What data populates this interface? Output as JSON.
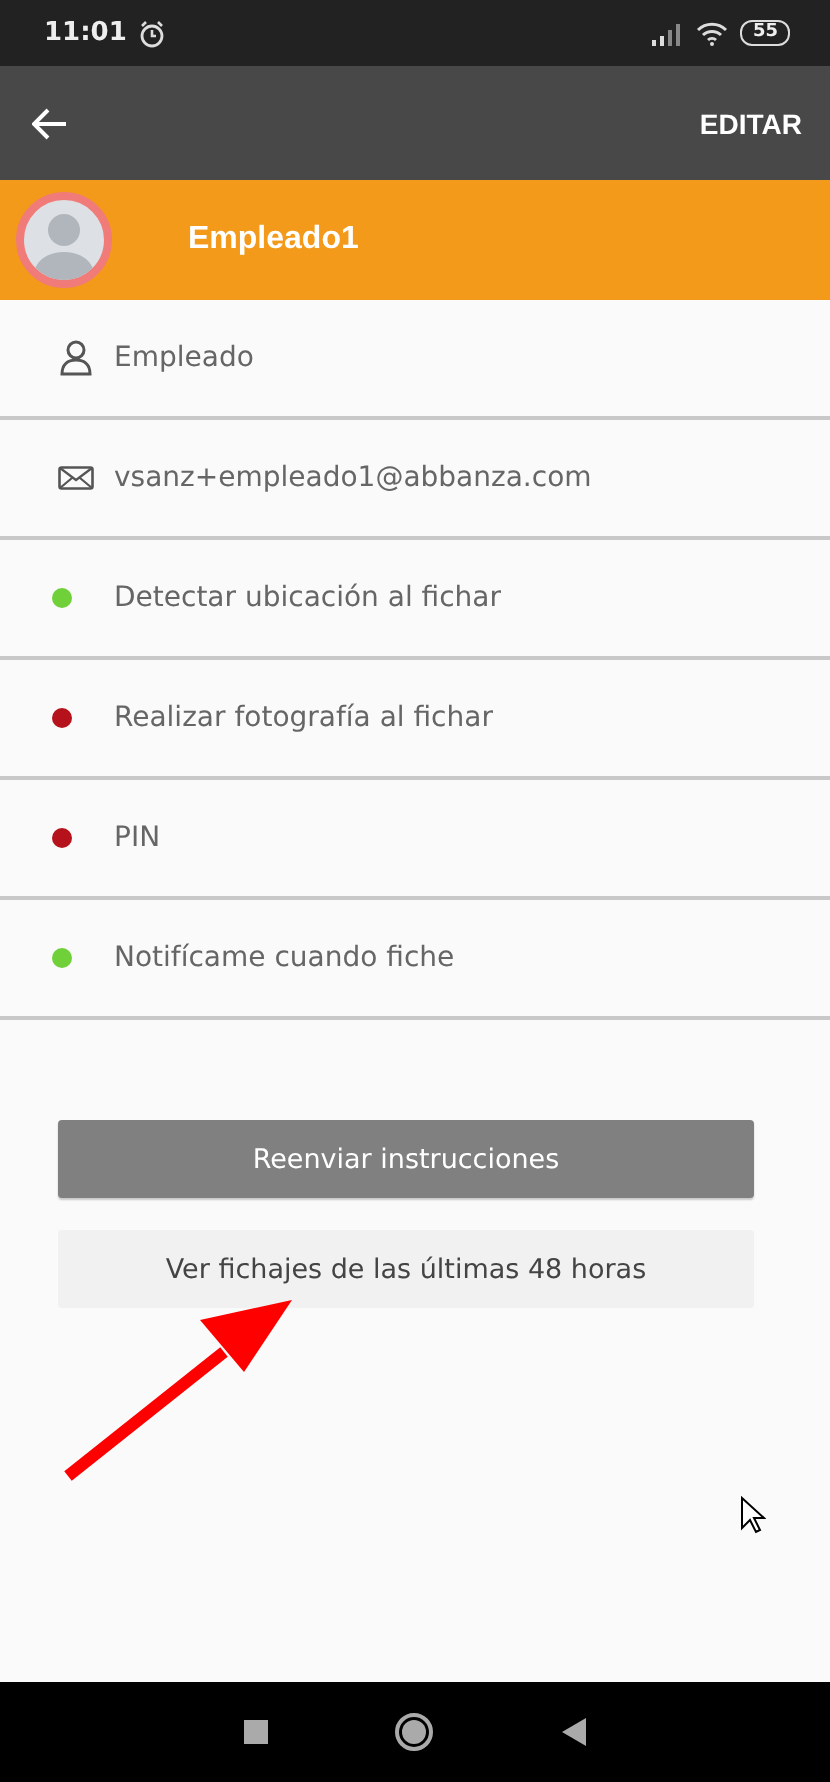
{
  "status_bar": {
    "time": "11:01",
    "battery": "55"
  },
  "app_bar": {
    "action": "EDITAR"
  },
  "profile": {
    "name": "Empleado1"
  },
  "info_rows": [
    {
      "kind": "role",
      "text": "Empleado"
    },
    {
      "kind": "email",
      "text": "vsanz+empleado1@abbanza.com"
    }
  ],
  "settings": [
    {
      "label": "Detectar ubicación al fichar",
      "color": "#6fd03a"
    },
    {
      "label": "Realizar fotografía al fichar",
      "color": "#b5121b"
    },
    {
      "label": "PIN",
      "color": "#b5121b"
    },
    {
      "label": "Notifícame cuando fiche",
      "color": "#6fd03a"
    }
  ],
  "buttons": [
    {
      "kind": "primary",
      "label": "Reenviar instrucciones"
    },
    {
      "kind": "secondary",
      "label": "Ver fichajes de las últimas 48 horas"
    }
  ]
}
